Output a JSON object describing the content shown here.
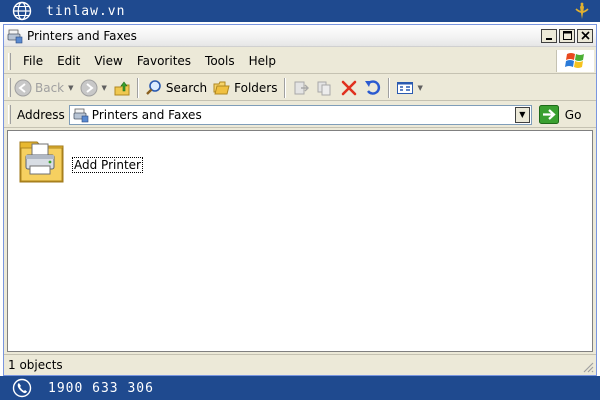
{
  "brand": {
    "site": "tinlaw.vn",
    "phone": "1900 633 306",
    "color": "#1f4a8f",
    "icons": [
      "globe-icon",
      "brand-logo-icon",
      "phone-icon"
    ]
  },
  "window": {
    "title": "Printers and Faxes",
    "controls": [
      "minimize",
      "maximize",
      "close"
    ]
  },
  "menu": {
    "items": [
      "File",
      "Edit",
      "View",
      "Favorites",
      "Tools",
      "Help"
    ]
  },
  "toolbar": {
    "back_label": "Back",
    "search_label": "Search",
    "folders_label": "Folders",
    "icons": [
      "back-icon",
      "forward-icon",
      "up-folder-icon",
      "search-icon",
      "folders-icon",
      "move-to-icon",
      "copy-to-icon",
      "delete-icon",
      "undo-icon",
      "views-icon"
    ]
  },
  "address": {
    "label": "Address",
    "value": "Printers and Faxes",
    "go_label": "Go"
  },
  "content": {
    "items": [
      {
        "label": "Add Printer",
        "icon": "add-printer-icon",
        "selected": true
      }
    ]
  },
  "status": {
    "text": "1 objects"
  }
}
